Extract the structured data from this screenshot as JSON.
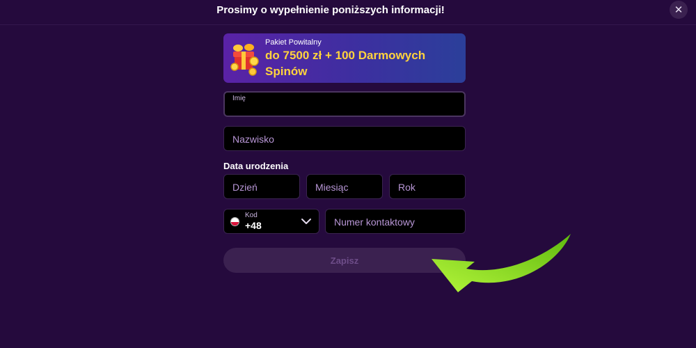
{
  "modal": {
    "title": "Prosimy o wypełnienie poniższych informacji!",
    "close_icon": "close-icon"
  },
  "banner": {
    "label": "Pakiet Powitalny",
    "offer": "do 7500 zł + 100 Darmowych Spinów",
    "icon": "gift-coins-icon"
  },
  "form": {
    "first_name": {
      "label": "Imię",
      "value": ""
    },
    "last_name": {
      "placeholder": "Nazwisko"
    },
    "birth_date": {
      "label": "Data urodzenia",
      "day": "Dzień",
      "month": "Miesiąc",
      "year": "Rok"
    },
    "phone": {
      "code_label": "Kod",
      "code_value": "+48",
      "flag": "poland-flag-icon",
      "number_placeholder": "Numer kontaktowy"
    },
    "submit_label": "Zapisz"
  },
  "colors": {
    "background": "#250a3d",
    "input_background": "#000000",
    "accent_yellow": "#ffd33d",
    "arrow_green": "#7ed31b",
    "button_disabled": "#3b2150"
  }
}
